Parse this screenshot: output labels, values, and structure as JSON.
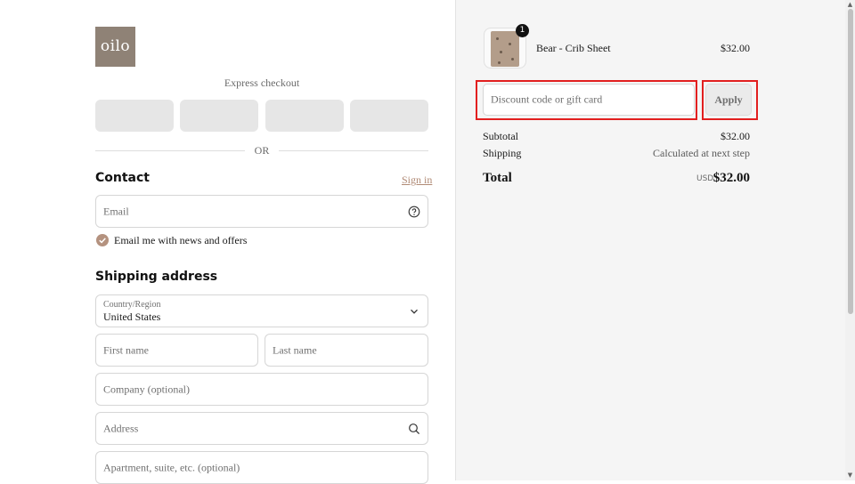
{
  "brand": {
    "logo_text": "oilo"
  },
  "express": {
    "label": "Express checkout",
    "or_text": "OR"
  },
  "contact": {
    "title": "Contact",
    "sign_in": "Sign in",
    "email_placeholder": "Email",
    "newsletter_label": "Email me with news and offers",
    "newsletter_checked": true
  },
  "shipping": {
    "title": "Shipping address",
    "country_label": "Country/Region",
    "country_value": "United States",
    "first_name_placeholder": "First name",
    "last_name_placeholder": "Last name",
    "company_placeholder": "Company (optional)",
    "address_placeholder": "Address",
    "apartment_placeholder": "Apartment, suite, etc. (optional)"
  },
  "cart": {
    "item": {
      "name": "Bear - Crib Sheet",
      "price": "$32.00",
      "quantity": "1"
    },
    "discount_placeholder": "Discount code or gift card",
    "apply_label": "Apply",
    "subtotal_label": "Subtotal",
    "subtotal_value": "$32.00",
    "shipping_label": "Shipping",
    "shipping_value": "Calculated at next step",
    "total_label": "Total",
    "total_currency": "USD",
    "total_value": "$32.00"
  },
  "colors": {
    "accent": "#b08a75",
    "highlight": "#e21f1f",
    "summary_bg": "#f5f5f5"
  }
}
